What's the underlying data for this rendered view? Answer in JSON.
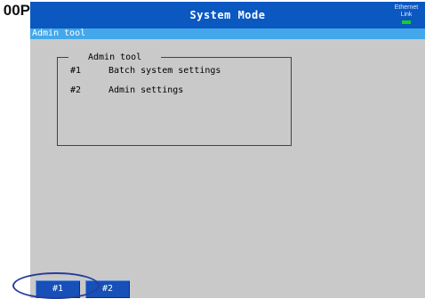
{
  "model_label": "00P",
  "titlebar": {
    "title": "System Mode",
    "ethernet_label": "Ethernet",
    "link_label": "Link",
    "link_color": "#18d01e"
  },
  "subheader": {
    "label": "Admin tool"
  },
  "menu_group": {
    "legend": "Admin tool",
    "items": [
      {
        "key": "#1",
        "label": "Batch system settings"
      },
      {
        "key": "#2",
        "label": "Admin settings"
      }
    ]
  },
  "softkeys": [
    {
      "label": "#1"
    },
    {
      "label": "#2"
    }
  ],
  "colors": {
    "titlebar": "#0a58c0",
    "subheader": "#43a7ea",
    "screen_bg": "#c9c9c9",
    "softkey": "#1650b8",
    "highlight": "#2a3d9a"
  }
}
